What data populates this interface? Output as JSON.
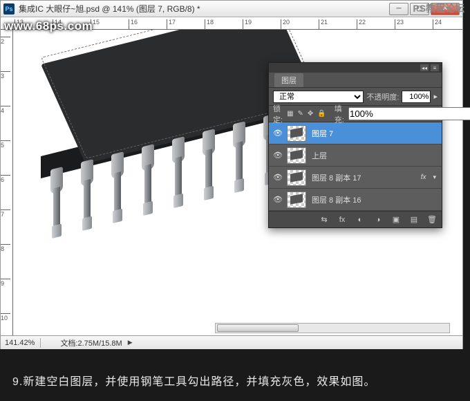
{
  "window": {
    "app_icon_text": "Ps",
    "title": "集成IC    大眼仔~旭.psd @ 141% (图层 7, RGB/8) *"
  },
  "watermarks": {
    "top_left": "www.68ps.com",
    "top_right": "PS教程论坛"
  },
  "ruler_h": [
    "13",
    "14",
    "15",
    "16",
    "17",
    "18",
    "19",
    "20",
    "21",
    "22",
    "23",
    "24"
  ],
  "ruler_v": [
    "2",
    "3",
    "4",
    "5",
    "6",
    "7",
    "8",
    "9",
    "10"
  ],
  "status": {
    "zoom": "141.42%",
    "doc_label": "文档:",
    "doc_value": "2.75M/15.8M"
  },
  "layers_panel": {
    "tab": "图层",
    "blend_mode": "正常",
    "opacity_label": "不透明度:",
    "opacity_value": "100%",
    "lock_label": "锁定:",
    "fill_label": "填充:",
    "fill_value": "100%",
    "layers": [
      {
        "name": "图层 7",
        "selected": true,
        "fx": false
      },
      {
        "name": "上层",
        "selected": false,
        "fx": false
      },
      {
        "name": "图层 8 副本 17",
        "selected": false,
        "fx": true
      },
      {
        "name": "图层 8 副本 16",
        "selected": false,
        "fx": false
      }
    ]
  },
  "caption": "9.新建空白图层，并使用钢笔工具勾出路径，并填充灰色，效果如图。",
  "icons": {
    "lock_trans": "▦",
    "lock_paint": "✎",
    "lock_move": "✥",
    "lock_all": "🔒",
    "eye": "👁",
    "link": "⇆",
    "fx": "fx",
    "mask": "◐",
    "adj": "◑",
    "group": "▣",
    "new": "▤",
    "trash": "🗑"
  }
}
